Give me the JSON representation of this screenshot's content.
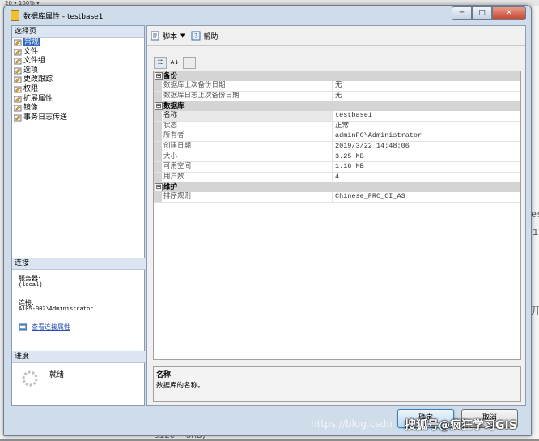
{
  "background": {
    "toolbar_text": "20 ▾   100% ▾",
    "right_frags": [
      "es",
      "1",
      "开"
    ],
    "bottom_text": "size= 5MB,"
  },
  "window": {
    "title": "数据库属性 - testbase1",
    "controls": [
      "─",
      "□",
      "✕"
    ]
  },
  "left_pane": {
    "header": "选择页",
    "pages": [
      "常规",
      "文件",
      "文件组",
      "选项",
      "更改跟踪",
      "权限",
      "扩展属性",
      "镜像",
      "事务日志传送"
    ],
    "selected_index": 0,
    "connection": {
      "header": "连接",
      "server_label": "服务器:",
      "server_value": "(local)",
      "conn_label": "连接:",
      "conn_value": "A105-002\\Administrator",
      "view_link": "查看连接属性"
    },
    "progress": {
      "header": "进度",
      "status": "就绪"
    }
  },
  "toolbar": {
    "script_label": "脚本",
    "help_label": "帮助"
  },
  "grid": {
    "categories": [
      {
        "name": "备份",
        "rows": [
          {
            "name": "数据库上次备份日期",
            "value": "无"
          },
          {
            "name": "数据库日志上次备份日期",
            "value": "无"
          }
        ]
      },
      {
        "name": "数据库",
        "rows": [
          {
            "name": "名称",
            "value": "testbase1"
          },
          {
            "name": "状态",
            "value": "正常"
          },
          {
            "name": "所有者",
            "value": "adminPC\\Administrator"
          },
          {
            "name": "创建日期",
            "value": "2019/3/22 14:48:06"
          },
          {
            "name": "大小",
            "value": "3.25 MB"
          },
          {
            "name": "可用空间",
            "value": "1.16 MB"
          },
          {
            "name": "用户数",
            "value": "4"
          }
        ]
      },
      {
        "name": "维护",
        "rows": [
          {
            "name": "排序规则",
            "value": "Chinese_PRC_CI_AS"
          }
        ]
      }
    ],
    "expand_glyph": "⊟"
  },
  "description": {
    "title": "名称",
    "text": "数据库的名称。"
  },
  "buttons": {
    "ok": "确定",
    "cancel": "取消"
  },
  "watermarks": {
    "blog": "https://blog.csdn",
    "sohu": "搜狐号@疯狂学习GIS"
  }
}
